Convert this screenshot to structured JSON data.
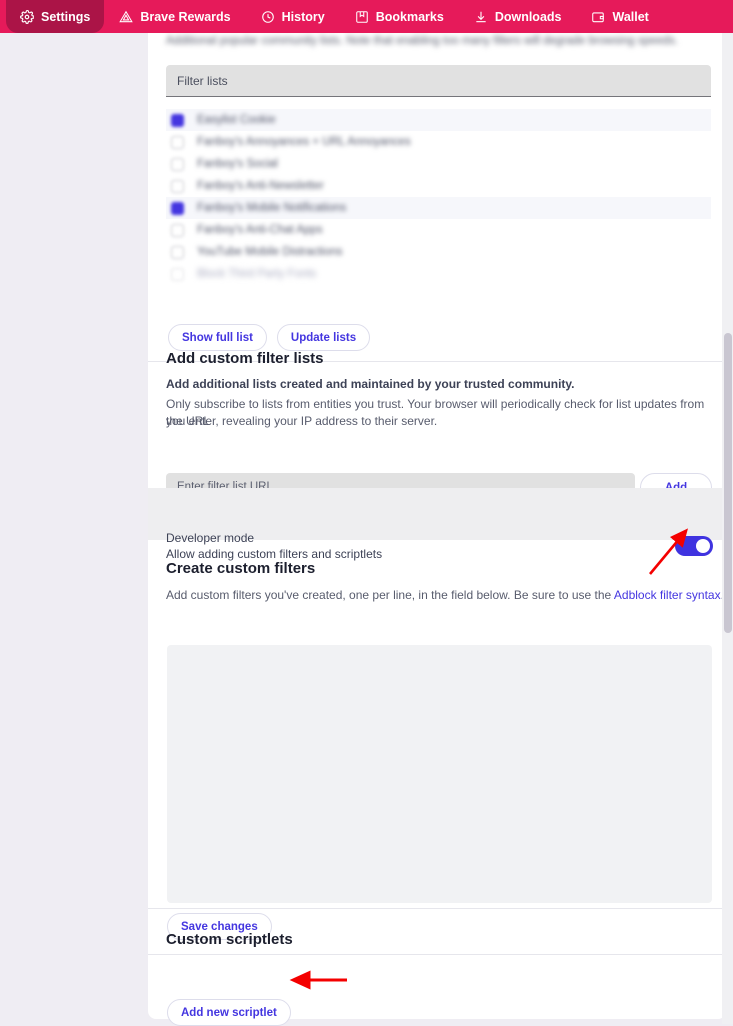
{
  "nav": {
    "items": [
      {
        "label": "Settings",
        "icon": "gear-icon",
        "active": true
      },
      {
        "label": "Brave Rewards",
        "icon": "triangle-icon",
        "active": false
      },
      {
        "label": "History",
        "icon": "clock-icon",
        "active": false
      },
      {
        "label": "Bookmarks",
        "icon": "book-icon",
        "active": false
      },
      {
        "label": "Downloads",
        "icon": "download-icon",
        "active": false
      },
      {
        "label": "Wallet",
        "icon": "wallet-icon",
        "active": false
      }
    ]
  },
  "intro": {
    "text": "Additional popular community lists. Note that enabling too many filters will degrade browsing speeds."
  },
  "filter_lists": {
    "search_label": "Filter lists",
    "rows": [
      {
        "label": "Easylist Cookie",
        "checked": true,
        "shaded": true,
        "faded": false
      },
      {
        "label": "Fanboy's Annoyances + URL Annoyances",
        "checked": false,
        "shaded": false,
        "faded": false
      },
      {
        "label": "Fanboy's Social",
        "checked": false,
        "shaded": false,
        "faded": false
      },
      {
        "label": "Fanboy's Anti-Newsletter",
        "checked": false,
        "shaded": false,
        "faded": false
      },
      {
        "label": "Fanboy's Mobile Notifications",
        "checked": true,
        "shaded": true,
        "faded": false
      },
      {
        "label": "Fanboy's Anti-Chat Apps",
        "checked": false,
        "shaded": false,
        "faded": false
      },
      {
        "label": "YouTube Mobile Distractions",
        "checked": false,
        "shaded": false,
        "faded": false
      },
      {
        "label": "Block Third Party Fonts",
        "checked": false,
        "shaded": false,
        "faded": true
      }
    ],
    "show_full_list": "Show full list",
    "update_lists": "Update lists"
  },
  "add_custom": {
    "title": "Add custom filter lists",
    "strong": "Add additional lists created and maintained by your trusted community.",
    "body_line1": "Only subscribe to lists from entities you trust. Your browser will periodically check for list updates from the URL",
    "body_line2": "you enter, revealing your IP address to their server.",
    "url_placeholder": "Enter filter list URL",
    "url_value": "",
    "add_label": "Add"
  },
  "developer_mode": {
    "title": "Developer mode",
    "subtitle": "Allow adding custom filters and scriptlets",
    "enabled": true,
    "toggle_color": "#3f33e0"
  },
  "create_filters": {
    "title": "Create custom filters",
    "desc_before": "Add custom filters you've created, one per line, in the field below. Be sure to use the ",
    "link_text": "Adblock filter syntax",
    "desc_after": ".",
    "textarea_value": "",
    "save_label": "Save changes"
  },
  "custom_scriptlets": {
    "title": "Custom scriptlets",
    "add_label": "Add new scriptlet"
  },
  "annotations": [
    {
      "name": "arrow-to-developer-toggle",
      "color": "#f40000",
      "direction": "up-right"
    },
    {
      "name": "arrow-to-add-new-scriptlet",
      "color": "#f40000",
      "direction": "left"
    }
  ],
  "colors": {
    "nav_background": "#e61a5a",
    "nav_active": "#ab1447",
    "accent_purple": "#4436e0",
    "page_background": "#efedf3",
    "card_background": "#ffffff"
  }
}
